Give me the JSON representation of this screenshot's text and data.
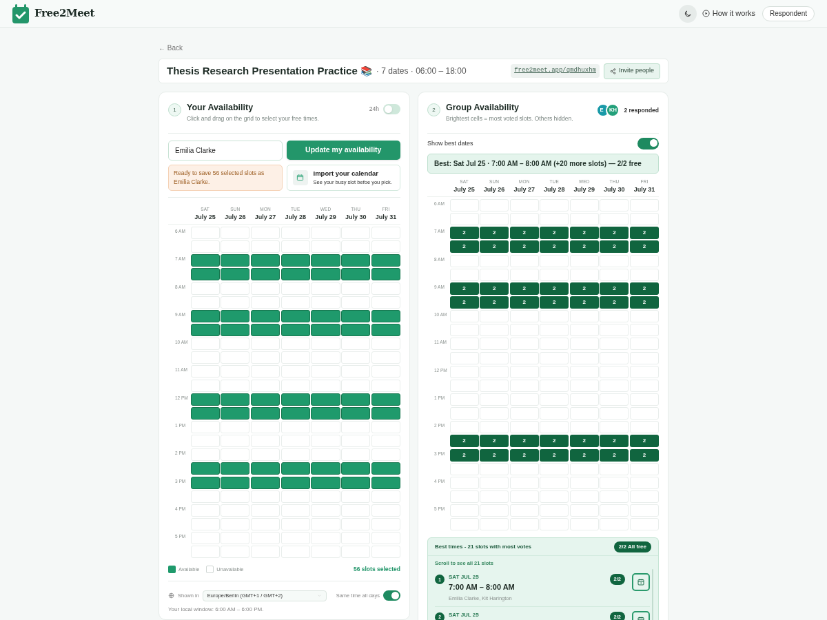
{
  "app": {
    "name": "Free2Meet",
    "how_it_works": "How it works",
    "role": "Respondent"
  },
  "back": "← Back",
  "event": {
    "title": "Thesis Research Presentation Practice",
    "emoji": "📚",
    "meta": "· 7 dates · 06:00 – 18:00",
    "link": "free2meet.app/qmdhuxhm",
    "invite": "Invite people"
  },
  "your_availability": {
    "step": "1",
    "title": "Your Availability",
    "subtitle": "Click and drag on the grid to select your free times.",
    "format_toggle": {
      "label": "24h",
      "on": false
    },
    "name_field": {
      "value": "Emilia Clarke"
    },
    "update_button": "Update my availability",
    "notice": "Ready to save 56 selected slots as Emilia Clarke.",
    "import": {
      "title": "Import your calendar",
      "subtitle": "See your busy slot befoe you pick."
    },
    "days": [
      {
        "weekday": "SAT",
        "date": "July 25"
      },
      {
        "weekday": "SUN",
        "date": "July 26"
      },
      {
        "weekday": "MON",
        "date": "July 27"
      },
      {
        "weekday": "TUE",
        "date": "July 28"
      },
      {
        "weekday": "WED",
        "date": "July 29"
      },
      {
        "weekday": "THU",
        "date": "July 30"
      },
      {
        "weekday": "FRI",
        "date": "July 31"
      }
    ],
    "rows": [
      {
        "time": "6 AM",
        "cells": [
          false,
          false,
          false,
          false,
          false,
          false,
          false
        ]
      },
      {
        "cells": [
          false,
          false,
          false,
          false,
          false,
          false,
          false
        ]
      },
      {
        "time": "7 AM",
        "cells": [
          true,
          true,
          true,
          true,
          true,
          true,
          true
        ]
      },
      {
        "cells": [
          true,
          true,
          true,
          true,
          true,
          true,
          true
        ]
      },
      {
        "time": "8 AM",
        "cells": [
          false,
          false,
          false,
          false,
          false,
          false,
          false
        ]
      },
      {
        "cells": [
          false,
          false,
          false,
          false,
          false,
          false,
          false
        ]
      },
      {
        "time": "9 AM",
        "cells": [
          true,
          true,
          true,
          true,
          true,
          true,
          true
        ]
      },
      {
        "cells": [
          true,
          true,
          true,
          true,
          true,
          true,
          true
        ]
      },
      {
        "time": "10 AM",
        "cells": [
          false,
          false,
          false,
          false,
          false,
          false,
          false
        ]
      },
      {
        "cells": [
          false,
          false,
          false,
          false,
          false,
          false,
          false
        ]
      },
      {
        "time": "11 AM",
        "cells": [
          false,
          false,
          false,
          false,
          false,
          false,
          false
        ]
      },
      {
        "cells": [
          false,
          false,
          false,
          false,
          false,
          false,
          false
        ]
      },
      {
        "time": "12 PM",
        "cells": [
          true,
          true,
          true,
          true,
          true,
          true,
          true
        ]
      },
      {
        "cells": [
          true,
          true,
          true,
          true,
          true,
          true,
          true
        ]
      },
      {
        "time": "1 PM",
        "cells": [
          false,
          false,
          false,
          false,
          false,
          false,
          false
        ]
      },
      {
        "cells": [
          false,
          false,
          false,
          false,
          false,
          false,
          false
        ]
      },
      {
        "time": "2 PM",
        "cells": [
          false,
          false,
          false,
          false,
          false,
          false,
          false
        ]
      },
      {
        "cells": [
          true,
          true,
          true,
          true,
          true,
          true,
          true
        ]
      },
      {
        "time": "3 PM",
        "cells": [
          true,
          true,
          true,
          true,
          true,
          true,
          true
        ]
      },
      {
        "cells": [
          false,
          false,
          false,
          false,
          false,
          false,
          false
        ]
      },
      {
        "time": "4 PM",
        "cells": [
          false,
          false,
          false,
          false,
          false,
          false,
          false
        ]
      },
      {
        "cells": [
          false,
          false,
          false,
          false,
          false,
          false,
          false
        ]
      },
      {
        "time": "5 PM",
        "cells": [
          false,
          false,
          false,
          false,
          false,
          false,
          false
        ]
      },
      {
        "cells": [
          false,
          false,
          false,
          false,
          false,
          false,
          false
        ]
      }
    ],
    "legend": [
      {
        "kind": "available",
        "label": "Available"
      },
      {
        "kind": "unavailable",
        "label": "Unavailable"
      }
    ],
    "selected_count": "56 slots selected",
    "timezone": {
      "label": "Shown in",
      "value": "Europe/Berlin (GMT+1 / GMT+2)"
    },
    "same_time": {
      "label": "Same time all days",
      "on": true
    },
    "local_window": "Your local window: 6:00 AM – 6:00 PM."
  },
  "group_availability": {
    "step": "2",
    "title": "Group Availability",
    "subtitle": "Brightest cells = most voted slots. Others hidden.",
    "avatars": [
      {
        "initials": "E",
        "color": "#1a9aa8"
      },
      {
        "initials": "KH",
        "color": "#23a07a"
      }
    ],
    "responded": "2 responded",
    "best_toggle": {
      "label": "Show best dates",
      "on": true
    },
    "best_banner": "Best: Sat Jul 25 · 7:00 AM – 8:00 AM (+20 more slots) — 2/2 free",
    "days": [
      {
        "weekday": "SAT",
        "date": "July 25"
      },
      {
        "weekday": "SUN",
        "date": "July 26"
      },
      {
        "weekday": "MON",
        "date": "July 27"
      },
      {
        "weekday": "TUE",
        "date": "July 28"
      },
      {
        "weekday": "WED",
        "date": "July 29"
      },
      {
        "weekday": "THU",
        "date": "July 30"
      },
      {
        "weekday": "FRI",
        "date": "July 31"
      }
    ],
    "rows": [
      {
        "time": "6 AM"
      },
      {},
      {
        "time": "7 AM",
        "votes": [
          "2",
          "2",
          "2",
          "2",
          "2",
          "2",
          "2"
        ]
      },
      {
        "votes": [
          "2",
          "2",
          "2",
          "2",
          "2",
          "2",
          "2"
        ]
      },
      {
        "time": "8 AM"
      },
      {},
      {
        "time": "9 AM",
        "votes": [
          "2",
          "2",
          "2",
          "2",
          "2",
          "2",
          "2"
        ]
      },
      {
        "votes": [
          "2",
          "2",
          "2",
          "2",
          "2",
          "2",
          "2"
        ]
      },
      {
        "time": "10 AM"
      },
      {},
      {
        "time": "11 AM"
      },
      {},
      {
        "time": "12 PM"
      },
      {},
      {
        "time": "1 PM"
      },
      {},
      {
        "time": "2 PM"
      },
      {
        "votes": [
          "2",
          "2",
          "2",
          "2",
          "2",
          "2",
          "2"
        ]
      },
      {
        "time": "3 PM",
        "votes": [
          "2",
          "2",
          "2",
          "2",
          "2",
          "2",
          "2"
        ]
      },
      {},
      {
        "time": "4 PM"
      },
      {},
      {
        "time": "5 PM"
      },
      {}
    ],
    "best_times": {
      "title": "Best times - 21 slots with most votes",
      "badge": "2/2 All free",
      "hint": "Scroll to see all 21 slots",
      "items": [
        {
          "rank": "1",
          "date": "SAT JUL 25",
          "time": "7:00 AM – 8:00 AM",
          "names": "Emilia Clarke, Kit Harington",
          "score": "2/2"
        },
        {
          "rank": "2",
          "date": "SAT JUL 25",
          "score": "2/2"
        }
      ]
    }
  }
}
